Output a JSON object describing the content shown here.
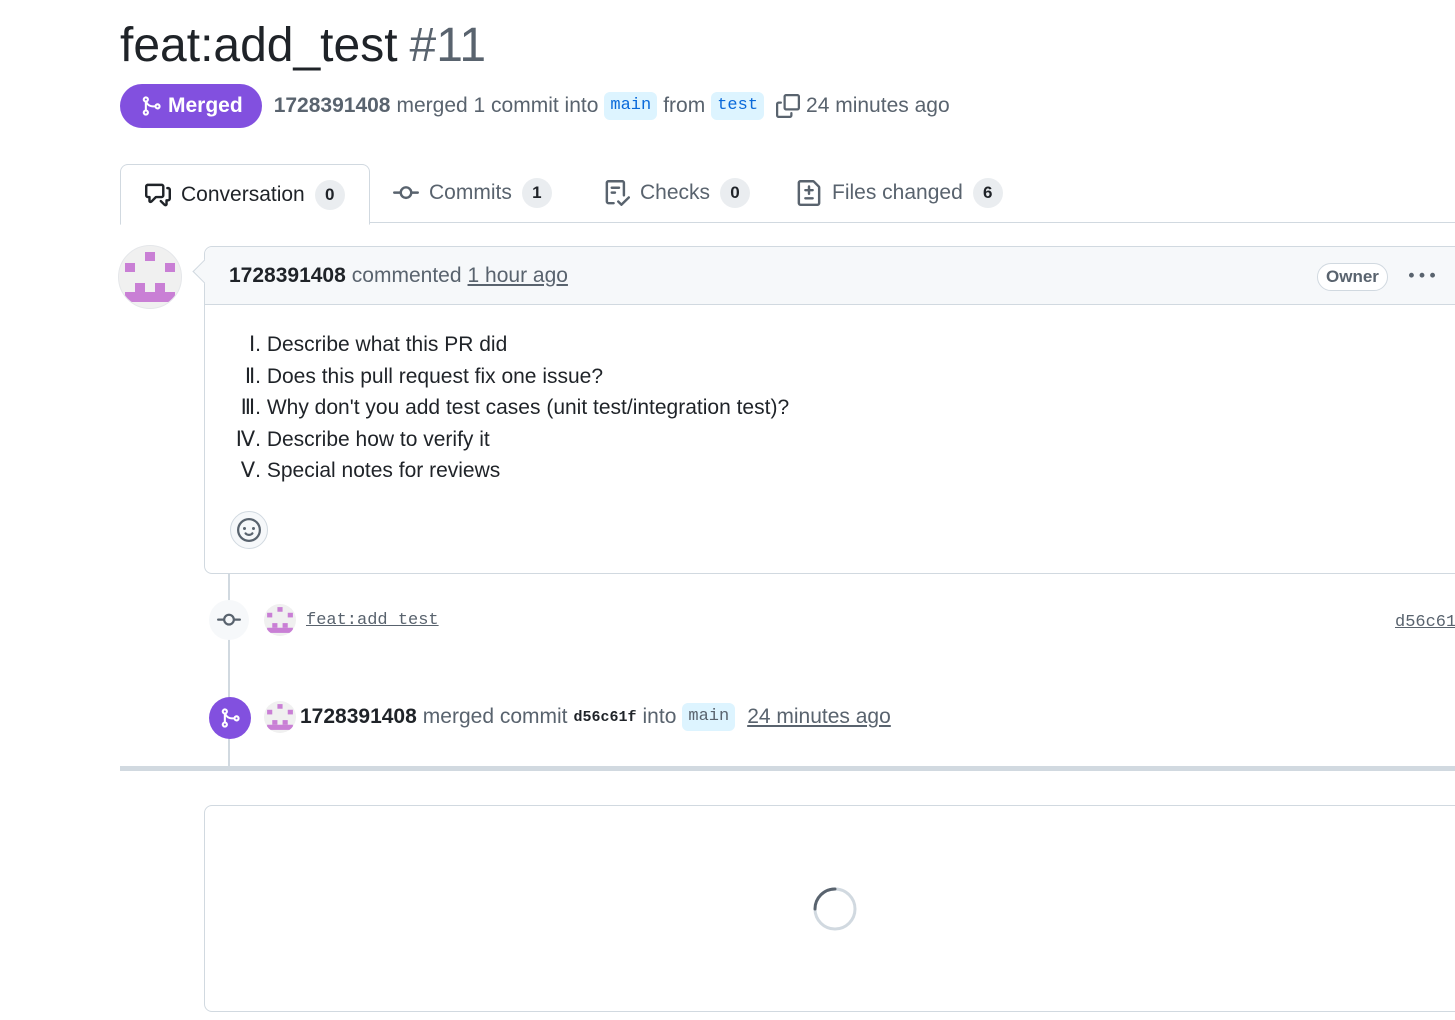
{
  "pr": {
    "title": "feat:add_test",
    "number": "#11",
    "state_label": "Merged",
    "author": "1728391408",
    "merged_text": "merged 1 commit into",
    "base_branch": "main",
    "from_text": "from",
    "head_branch": "test",
    "merged_time": "24 minutes ago"
  },
  "tabs": [
    {
      "label": "Conversation",
      "count": "0",
      "icon": "comment-discussion-icon"
    },
    {
      "label": "Commits",
      "count": "1",
      "icon": "git-commit-icon"
    },
    {
      "label": "Checks",
      "count": "0",
      "icon": "checklist-icon"
    },
    {
      "label": "Files changed",
      "count": "6",
      "icon": "file-diff-icon"
    }
  ],
  "comment": {
    "author": "1728391408",
    "action": "commented",
    "time": "1 hour ago",
    "role_badge": "Owner",
    "lines": [
      {
        "num": "Ⅰ.",
        "text": " Describe what this PR did"
      },
      {
        "num": "Ⅱ.",
        "text": " Does this pull request fix one issue?"
      },
      {
        "num": "Ⅲ.",
        "text": " Why don't you add test cases (unit test/integration test)?"
      },
      {
        "num": "Ⅳ.",
        "text": " Describe how to verify it"
      },
      {
        "num": "Ⅴ.",
        "text": " Special notes for reviews"
      }
    ]
  },
  "timeline": {
    "commit": {
      "message": "feat:add_test",
      "sha": "d56c61"
    },
    "merge": {
      "author": "1728391408",
      "text1": "merged commit",
      "sha": "d56c61f",
      "text2": "into",
      "branch": "main",
      "time": "24 minutes ago"
    }
  },
  "colors": {
    "merged": "#8250df",
    "branch_bg": "#ddf4ff",
    "branch_fg": "#0969da",
    "avatar": "#c97fd5"
  }
}
